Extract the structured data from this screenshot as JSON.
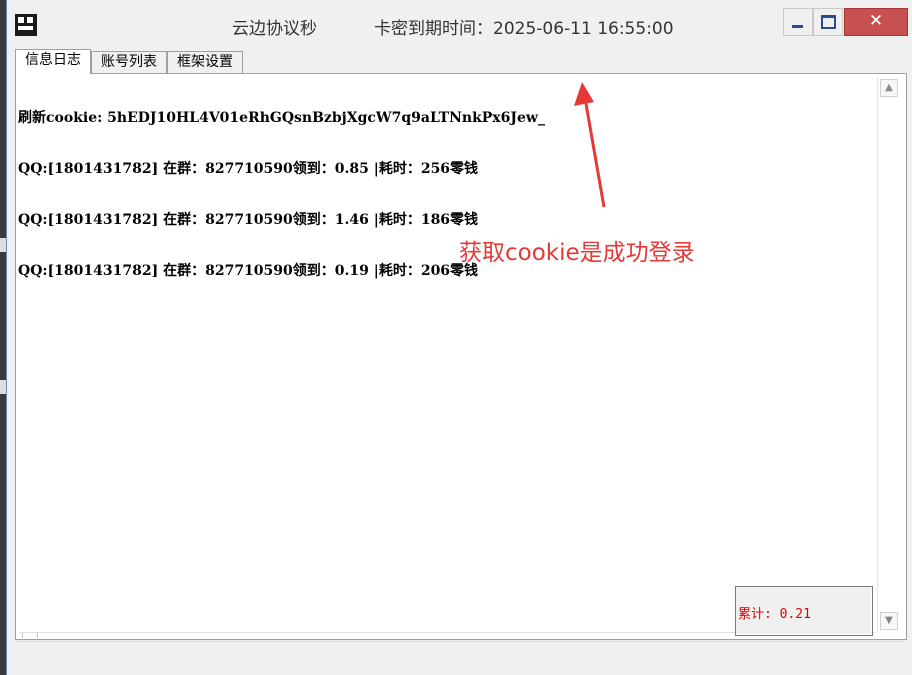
{
  "window": {
    "title": "云边协议秒",
    "expiry": "卡密到期时间：2025-06-11 16:55:00",
    "close_glyph": "✕",
    "min_glyph": "",
    "max_glyph": ""
  },
  "tabs": [
    {
      "label": "信息日志",
      "active": true
    },
    {
      "label": "账号列表",
      "active": false
    },
    {
      "label": "框架设置",
      "active": false
    }
  ],
  "log": [
    "刷新cookie: 5hEDJ10HL4V01eRhGQsnBzbjXgcW7q9aLTNnkPx6Jew_",
    "QQ:[1801431782] 在群：827710590领到：0.85 |耗时：256零钱",
    "QQ:[1801431782] 在群：827710590领到：1.46 |耗时：186零钱",
    "QQ:[1801431782] 在群：827710590领到：0.19 |耗时：206零钱"
  ],
  "annotation": "获取cookie是成功登录",
  "total": "累计: 0.21",
  "scroll": {
    "up_glyph": "▲",
    "down_glyph": "▼"
  },
  "colors": {
    "accent_red": "#e53935",
    "close_red": "#c75050",
    "total_red": "#e00000"
  },
  "icons": [
    "app-icon",
    "minimize-icon",
    "maximize-icon",
    "close-icon",
    "arrow-annotation-icon"
  ]
}
